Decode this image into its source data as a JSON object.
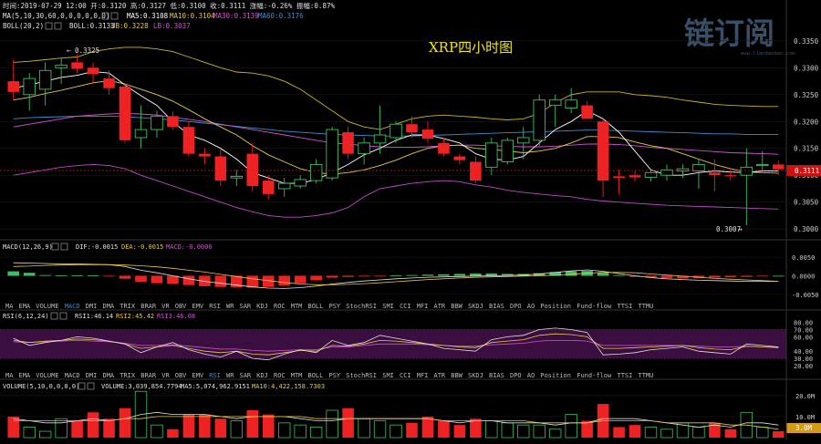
{
  "header": {
    "info_line": "时间:2019-07-29 12:00  开:0.3120  高:0.3127  低:0.3100  收:0.3111  涨幅:-0.26%  振幅:0.87%",
    "ma_label": "MA(5,10,30,60,0,0,0,0,0,0)",
    "ma5": "MA5:0.3108",
    "ma10": "MA10:0.3104",
    "ma30": "MA30:0.3139",
    "ma60": "MA60:0.3176",
    "boll_label": "BOLL(20,2)",
    "boll_val": "BOLL:0.3133",
    "boll_ub": "UB:0.3228",
    "boll_lb": "LB:0.3037",
    "watermark": "链订阅",
    "watermark_url": "www.liandaodao.com"
  },
  "main_panel": {
    "title": "XRP四小时图",
    "high_marker": "0.3325",
    "low_marker": "0.3007",
    "price_tag": "0.3111",
    "y_ticks": [
      "0.3350",
      "0.3300",
      "0.3250",
      "0.3200",
      "0.3150",
      "0.3100",
      "0.3050",
      "0.3000"
    ]
  },
  "macd_panel": {
    "label": "MACD(12,26,9)",
    "dif": "DIF:-0.0015",
    "dea": "DEA:-0.0015",
    "macd": "MACD:-0.0000",
    "y_ticks": [
      "0.0050",
      "0.0000",
      "-0.0050"
    ]
  },
  "rsi_panel": {
    "label": "RSI(6,12,24)",
    "rsi1": "RSI1:46.14",
    "rsi2": "RSI2:45.42",
    "rsi3": "RSI3:46.08",
    "y_ticks": [
      "80.00",
      "70.00",
      "60.00",
      "40.00",
      "30.00",
      "20.00"
    ]
  },
  "volume_panel": {
    "label": "VOLUME(5,10,0,0,0,0)",
    "volume": "VOLUME:3,039,854.7794",
    "ma5": "MA5:5,074,962.9151",
    "ma10": "MA10:4,422,158.7303",
    "y_ticks": [
      "20.0M",
      "10.0M"
    ],
    "current_tag": "3.0M"
  },
  "indicator_tabs_1": [
    "MA",
    "EMA",
    "VOLUME",
    "MACD",
    "DMI",
    "DMA",
    "TRIX",
    "BRAR",
    "VR",
    "OBV",
    "EMV",
    "RSI",
    "WR",
    "SAR",
    "KDJ",
    "ROC",
    "MTM",
    "BOLL",
    "PSY",
    "StochRSI",
    "SMI",
    "CCI",
    "MFI",
    "ATR",
    "BBW",
    "SKDJ",
    "BIAS",
    "DPO",
    "AO",
    "Position",
    "Fund-flow",
    "TTSI",
    "TTMU"
  ],
  "indicator_tabs_2": [
    "MA",
    "EMA",
    "VOLUME",
    "MACD",
    "DMI",
    "DMA",
    "TRIX",
    "BRAR",
    "VR",
    "OBV",
    "EMV",
    "RSI",
    "WR",
    "SAR",
    "KDJ",
    "ROC",
    "MTM",
    "BOLL",
    "PSY",
    "StochRSI",
    "SMI",
    "CCI",
    "MFI",
    "ATR",
    "BBW",
    "SKDJ",
    "BIAS",
    "DPO",
    "AO",
    "Position",
    "Fund-flow",
    "TTSI",
    "TTMU"
  ],
  "active_tab_1": "MACD",
  "active_tab_2": "RSI",
  "colors": {
    "up": "#3fbf5f",
    "down": "#ee2222",
    "ma5": "#ffffff",
    "ma10": "#e6c84c",
    "ma30": "#d055d0",
    "ma60": "#3a8fd0",
    "boll_mid": "#e0e0e0",
    "boll_ub": "#c8b428",
    "boll_lb": "#c04ac8",
    "rsi_band": "#3a0f3f"
  },
  "chart_data": [
    {
      "type": "candlestick",
      "title": "XRP四小时图",
      "ylim": [
        0.2985,
        0.3365
      ],
      "candles": [
        {
          "o": 0.3275,
          "h": 0.3315,
          "l": 0.324,
          "c": 0.3255
        },
        {
          "o": 0.325,
          "h": 0.329,
          "l": 0.322,
          "c": 0.328
        },
        {
          "o": 0.326,
          "h": 0.331,
          "l": 0.323,
          "c": 0.3295
        },
        {
          "o": 0.33,
          "h": 0.3318,
          "l": 0.327,
          "c": 0.3305
        },
        {
          "o": 0.331,
          "h": 0.3325,
          "l": 0.329,
          "c": 0.3298
        },
        {
          "o": 0.33,
          "h": 0.331,
          "l": 0.327,
          "c": 0.3288
        },
        {
          "o": 0.328,
          "h": 0.3295,
          "l": 0.325,
          "c": 0.3262
        },
        {
          "o": 0.3265,
          "h": 0.327,
          "l": 0.316,
          "c": 0.3165
        },
        {
          "o": 0.317,
          "h": 0.323,
          "l": 0.315,
          "c": 0.3185
        },
        {
          "o": 0.3185,
          "h": 0.322,
          "l": 0.317,
          "c": 0.321
        },
        {
          "o": 0.321,
          "h": 0.3218,
          "l": 0.3185,
          "c": 0.319
        },
        {
          "o": 0.319,
          "h": 0.32,
          "l": 0.3135,
          "c": 0.314
        },
        {
          "o": 0.314,
          "h": 0.315,
          "l": 0.312,
          "c": 0.3135
        },
        {
          "o": 0.3135,
          "h": 0.3148,
          "l": 0.308,
          "c": 0.309
        },
        {
          "o": 0.3095,
          "h": 0.311,
          "l": 0.308,
          "c": 0.3098
        },
        {
          "o": 0.314,
          "h": 0.316,
          "l": 0.307,
          "c": 0.308
        },
        {
          "o": 0.309,
          "h": 0.31,
          "l": 0.3055,
          "c": 0.3065
        },
        {
          "o": 0.3075,
          "h": 0.3095,
          "l": 0.306,
          "c": 0.3085
        },
        {
          "o": 0.308,
          "h": 0.31,
          "l": 0.3075,
          "c": 0.3092
        },
        {
          "o": 0.309,
          "h": 0.313,
          "l": 0.3085,
          "c": 0.312
        },
        {
          "o": 0.3095,
          "h": 0.319,
          "l": 0.309,
          "c": 0.3185
        },
        {
          "o": 0.318,
          "h": 0.319,
          "l": 0.313,
          "c": 0.314
        },
        {
          "o": 0.314,
          "h": 0.317,
          "l": 0.312,
          "c": 0.316
        },
        {
          "o": 0.316,
          "h": 0.323,
          "l": 0.314,
          "c": 0.3175
        },
        {
          "o": 0.317,
          "h": 0.32,
          "l": 0.316,
          "c": 0.3195
        },
        {
          "o": 0.3195,
          "h": 0.321,
          "l": 0.317,
          "c": 0.318
        },
        {
          "o": 0.3185,
          "h": 0.32,
          "l": 0.316,
          "c": 0.3168
        },
        {
          "o": 0.316,
          "h": 0.317,
          "l": 0.3135,
          "c": 0.314
        },
        {
          "o": 0.3135,
          "h": 0.314,
          "l": 0.312,
          "c": 0.3128
        },
        {
          "o": 0.3125,
          "h": 0.3135,
          "l": 0.3085,
          "c": 0.309
        },
        {
          "o": 0.3115,
          "h": 0.317,
          "l": 0.31,
          "c": 0.316
        },
        {
          "o": 0.3125,
          "h": 0.317,
          "l": 0.312,
          "c": 0.3165
        },
        {
          "o": 0.316,
          "h": 0.319,
          "l": 0.313,
          "c": 0.317
        },
        {
          "o": 0.3165,
          "h": 0.325,
          "l": 0.3155,
          "c": 0.324
        },
        {
          "o": 0.323,
          "h": 0.325,
          "l": 0.319,
          "c": 0.324
        },
        {
          "o": 0.3225,
          "h": 0.3262,
          "l": 0.3215,
          "c": 0.324
        },
        {
          "o": 0.323,
          "h": 0.3238,
          "l": 0.3205,
          "c": 0.3205
        },
        {
          "o": 0.32,
          "h": 0.3205,
          "l": 0.306,
          "c": 0.309
        },
        {
          "o": 0.3098,
          "h": 0.311,
          "l": 0.3065,
          "c": 0.3095
        },
        {
          "o": 0.31,
          "h": 0.3108,
          "l": 0.3088,
          "c": 0.3096
        },
        {
          "o": 0.3096,
          "h": 0.311,
          "l": 0.3088,
          "c": 0.3105
        },
        {
          "o": 0.31,
          "h": 0.312,
          "l": 0.309,
          "c": 0.311
        },
        {
          "o": 0.3108,
          "h": 0.312,
          "l": 0.3095,
          "c": 0.3112
        },
        {
          "o": 0.3108,
          "h": 0.313,
          "l": 0.3075,
          "c": 0.312
        },
        {
          "o": 0.3105,
          "h": 0.313,
          "l": 0.307,
          "c": 0.31
        },
        {
          "o": 0.31,
          "h": 0.311,
          "l": 0.309,
          "c": 0.3098
        },
        {
          "o": 0.31,
          "h": 0.315,
          "l": 0.3007,
          "c": 0.3115
        },
        {
          "o": 0.3118,
          "h": 0.3145,
          "l": 0.311,
          "c": 0.312
        },
        {
          "o": 0.312,
          "h": 0.3127,
          "l": 0.31,
          "c": 0.3111
        }
      ],
      "ma5": [
        0.3262,
        0.3268,
        0.3275,
        0.3282,
        0.3286,
        0.3293,
        0.329,
        0.3268,
        0.3248,
        0.323,
        0.32,
        0.3175,
        0.3165,
        0.315,
        0.313,
        0.3105,
        0.3095,
        0.3085,
        0.3085,
        0.3092,
        0.3105,
        0.312,
        0.3138,
        0.315,
        0.3165,
        0.3175,
        0.3175,
        0.3168,
        0.316,
        0.314,
        0.313,
        0.3128,
        0.3135,
        0.316,
        0.3185,
        0.32,
        0.322,
        0.3205,
        0.318,
        0.3145,
        0.311,
        0.31,
        0.31,
        0.3105,
        0.3108,
        0.3106,
        0.3105,
        0.3108,
        0.3108
      ],
      "ma10": [
        0.324,
        0.3245,
        0.3252,
        0.3258,
        0.3265,
        0.3272,
        0.3276,
        0.327,
        0.326,
        0.325,
        0.3238,
        0.3222,
        0.3205,
        0.319,
        0.3175,
        0.3155,
        0.3138,
        0.3125,
        0.3112,
        0.3105,
        0.3102,
        0.3105,
        0.311,
        0.3118,
        0.3128,
        0.314,
        0.315,
        0.3155,
        0.3156,
        0.315,
        0.3148,
        0.3145,
        0.3142,
        0.3145,
        0.315,
        0.316,
        0.3172,
        0.3172,
        0.317,
        0.3162,
        0.3155,
        0.315,
        0.314,
        0.313,
        0.312,
        0.3112,
        0.3106,
        0.3105,
        0.3104
      ],
      "ma30": [
        0.319,
        0.3195,
        0.32,
        0.3205,
        0.321,
        0.3212,
        0.3214,
        0.3215,
        0.3214,
        0.3212,
        0.3208,
        0.3204,
        0.32,
        0.3195,
        0.319,
        0.3185,
        0.318,
        0.3175,
        0.317,
        0.3165,
        0.316,
        0.3158,
        0.3155,
        0.3153,
        0.3152,
        0.3152,
        0.3153,
        0.3155,
        0.3156,
        0.3156,
        0.3155,
        0.3154,
        0.3153,
        0.3153,
        0.3154,
        0.3156,
        0.3158,
        0.3158,
        0.3157,
        0.3155,
        0.3152,
        0.315,
        0.3148,
        0.3146,
        0.3144,
        0.3142,
        0.3141,
        0.314,
        0.3139
      ],
      "ma60": [
        0.3205,
        0.3207,
        0.3208,
        0.3209,
        0.321,
        0.321,
        0.321,
        0.3209,
        0.3207,
        0.3205,
        0.3203,
        0.32,
        0.3197,
        0.3194,
        0.3191,
        0.3188,
        0.3185,
        0.3182,
        0.318,
        0.3178,
        0.3176,
        0.3175,
        0.3174,
        0.3173,
        0.3173,
        0.3173,
        0.3174,
        0.3175,
        0.3176,
        0.3177,
        0.3178,
        0.3179,
        0.318,
        0.3181,
        0.3182,
        0.3183,
        0.3184,
        0.3184,
        0.3183,
        0.3182,
        0.3181,
        0.318,
        0.3179,
        0.3178,
        0.3177,
        0.3177,
        0.3176,
        0.3176,
        0.3176
      ],
      "boll_ub": [
        0.331,
        0.3312,
        0.3315,
        0.3318,
        0.332,
        0.333,
        0.3335,
        0.3338,
        0.3338,
        0.3335,
        0.333,
        0.332,
        0.331,
        0.33,
        0.3292,
        0.329,
        0.3285,
        0.3275,
        0.326,
        0.324,
        0.322,
        0.32,
        0.319,
        0.3185,
        0.3195,
        0.3205,
        0.321,
        0.3212,
        0.321,
        0.3208,
        0.3205,
        0.3203,
        0.3205,
        0.3215,
        0.3235,
        0.325,
        0.3255,
        0.3255,
        0.3255,
        0.325,
        0.3248,
        0.3245,
        0.324,
        0.3236,
        0.3232,
        0.323,
        0.3229,
        0.3228,
        0.3228
      ],
      "boll_lb": [
        0.31,
        0.3105,
        0.311,
        0.3115,
        0.3118,
        0.312,
        0.3118,
        0.3112,
        0.31,
        0.309,
        0.308,
        0.307,
        0.306,
        0.305,
        0.304,
        0.3032,
        0.3025,
        0.3022,
        0.3022,
        0.3025,
        0.303,
        0.304,
        0.306,
        0.3075,
        0.308,
        0.3085,
        0.3088,
        0.309,
        0.3088,
        0.3082,
        0.3078,
        0.3072,
        0.3068,
        0.3065,
        0.3062,
        0.306,
        0.3055,
        0.3052,
        0.305,
        0.3048,
        0.3046,
        0.3044,
        0.3043,
        0.3042,
        0.3041,
        0.304,
        0.3039,
        0.3038,
        0.3037
      ]
    },
    {
      "type": "bar",
      "title": "MACD(12,26,9)",
      "ylim": [
        -0.0065,
        0.0065
      ],
      "hist": [
        0.0012,
        0.0008,
        0.0002,
        0.0001,
        0.0001,
        0.0001,
        -0.0001,
        -0.0008,
        -0.0016,
        -0.002,
        -0.0022,
        -0.0025,
        -0.0028,
        -0.003,
        -0.0031,
        -0.0032,
        -0.003,
        -0.0026,
        -0.002,
        -0.0012,
        -0.0005,
        -0.0003,
        -0.0002,
        -0.0001,
        0.0001,
        0.0002,
        0.0003,
        0.0004,
        0.0005,
        0.0006,
        0.0006,
        0.0005,
        0.0005,
        0.0007,
        0.001,
        0.0012,
        0.0013,
        0.0008,
        0.0002,
        -0.0003,
        -0.0005,
        -0.0006,
        -0.0007,
        -0.0006,
        -0.0005,
        -0.0004,
        -0.0003,
        -0.0001,
        0.0
      ],
      "dif": [
        0.0035,
        0.0034,
        0.0033,
        0.0032,
        0.0032,
        0.0031,
        0.003,
        0.0025,
        0.0015,
        0.0008,
        0.0,
        -0.0008,
        -0.0015,
        -0.002,
        -0.0025,
        -0.003,
        -0.0033,
        -0.0034,
        -0.0032,
        -0.0028,
        -0.0022,
        -0.0018,
        -0.0014,
        -0.0011,
        -0.0008,
        -0.0006,
        -0.0004,
        -0.0003,
        -0.0002,
        -0.0001,
        0.0,
        0.0001,
        0.0002,
        0.0005,
        0.0009,
        0.0013,
        0.0016,
        0.0012,
        0.0006,
        0.0,
        -0.0005,
        -0.0008,
        -0.001,
        -0.0012,
        -0.0013,
        -0.0014,
        -0.0015,
        -0.0015,
        -0.0015
      ],
      "dea": [
        0.0025,
        0.0026,
        0.0028,
        0.0029,
        0.003,
        0.003,
        0.003,
        0.0029,
        0.0027,
        0.0024,
        0.002,
        0.0015,
        0.001,
        0.0004,
        -0.0002,
        -0.0008,
        -0.0013,
        -0.0018,
        -0.0022,
        -0.0024,
        -0.0024,
        -0.0023,
        -0.0021,
        -0.0019,
        -0.0016,
        -0.0013,
        -0.001,
        -0.0008,
        -0.0006,
        -0.0004,
        -0.0003,
        -0.0002,
        -0.0001,
        0.0,
        0.0002,
        0.0004,
        0.0007,
        0.0009,
        0.0009,
        0.0008,
        0.0005,
        0.0002,
        -0.0001,
        -0.0004,
        -0.0007,
        -0.0009,
        -0.0011,
        -0.0013,
        -0.0015
      ]
    },
    {
      "type": "line",
      "title": "RSI(6,12,24)",
      "ylim": [
        15,
        82
      ],
      "rsi1": [
        58,
        48,
        52,
        55,
        60,
        58,
        54,
        50,
        38,
        46,
        52,
        42,
        36,
        32,
        40,
        30,
        28,
        36,
        42,
        38,
        55,
        48,
        52,
        62,
        58,
        54,
        50,
        44,
        42,
        40,
        56,
        60,
        62,
        70,
        72,
        70,
        66,
        35,
        36,
        38,
        42,
        44,
        46,
        40,
        38,
        36,
        50,
        48,
        46
      ],
      "rsi2": [
        55,
        52,
        54,
        55,
        57,
        56,
        54,
        50,
        44,
        46,
        48,
        44,
        40,
        38,
        40,
        36,
        35,
        38,
        41,
        40,
        48,
        47,
        50,
        55,
        54,
        52,
        50,
        48,
        46,
        45,
        52,
        54,
        56,
        62,
        64,
        63,
        60,
        44,
        44,
        45,
        46,
        47,
        48,
        45,
        43,
        42,
        47,
        46,
        45
      ],
      "rsi3": [
        53,
        52,
        53,
        54,
        55,
        54,
        53,
        51,
        48,
        48,
        49,
        47,
        45,
        43,
        43,
        41,
        40,
        41,
        42,
        42,
        46,
        46,
        48,
        50,
        50,
        50,
        49,
        48,
        47,
        47,
        49,
        50,
        51,
        54,
        55,
        55,
        54,
        48,
        48,
        48,
        48,
        48,
        48,
        47,
        46,
        46,
        47,
        46,
        46
      ]
    },
    {
      "type": "bar",
      "title": "VOLUME(5,10,0,0,0,0)",
      "ylim": [
        0,
        26
      ],
      "volume": [
        10,
        5,
        3,
        9,
        8,
        12,
        9,
        14,
        22,
        6,
        4,
        11,
        11,
        9,
        8,
        13,
        11,
        7,
        6,
        5,
        13,
        14,
        9,
        8,
        6,
        7,
        10,
        8,
        6,
        9,
        8,
        7,
        6,
        6,
        4,
        11,
        8,
        16,
        5,
        6,
        5,
        4,
        7,
        5,
        7,
        4,
        12,
        5,
        3
      ],
      "vol_ma5": [
        9,
        8,
        7,
        7,
        8,
        9,
        8,
        9,
        11,
        12,
        11,
        11,
        11,
        10,
        9,
        10,
        10,
        10,
        9,
        8,
        8,
        9,
        9,
        9,
        9,
        9,
        9,
        8,
        7,
        8,
        8,
        7,
        7,
        7,
        6,
        7,
        7,
        9,
        9,
        9,
        8,
        7,
        6,
        5,
        6,
        5,
        7,
        7,
        6
      ],
      "vol_ma10": [
        8,
        8,
        8,
        8,
        8,
        8,
        8,
        9,
        9,
        10,
        10,
        10,
        10,
        10,
        10,
        10,
        10,
        10,
        10,
        9,
        9,
        9,
        9,
        9,
        9,
        9,
        9,
        8,
        8,
        8,
        8,
        8,
        8,
        7,
        7,
        7,
        7,
        8,
        8,
        8,
        8,
        7,
        7,
        7,
        7,
        6,
        6,
        5,
        4
      ]
    }
  ]
}
